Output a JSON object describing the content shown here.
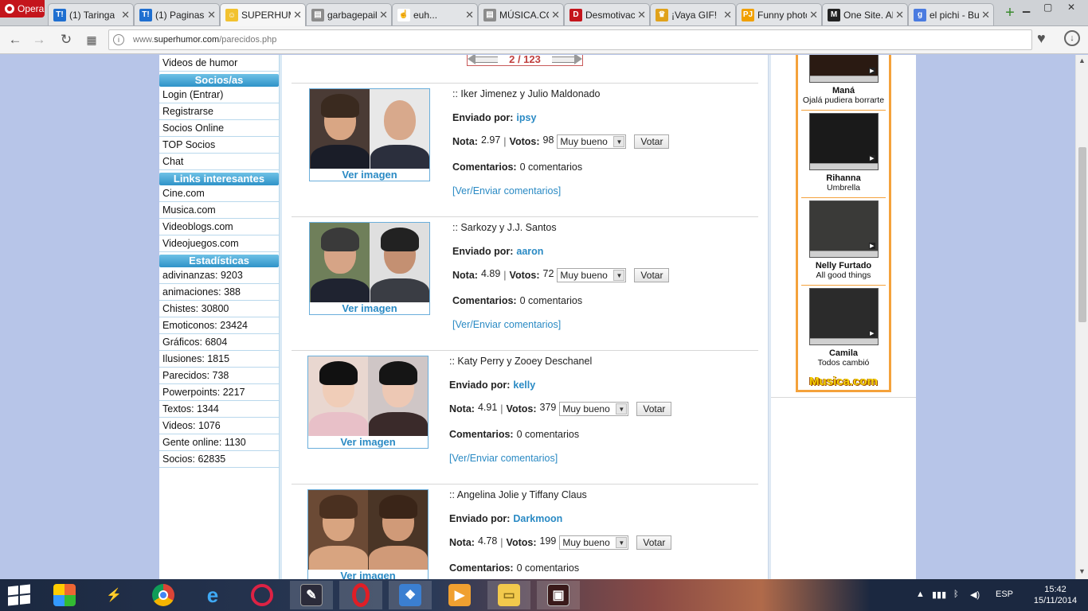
{
  "browser": {
    "menu_label": "Opera",
    "tabs": [
      {
        "label": "(1) Taringa",
        "icon": "taringa-icon",
        "color": "#1f6fd0",
        "glyph": "T!"
      },
      {
        "label": "(1) Paginas",
        "icon": "taringa-icon",
        "color": "#1f6fd0",
        "glyph": "T!"
      },
      {
        "label": "SUPERHUMOR",
        "icon": "smiley-icon",
        "color": "#f2c230",
        "glyph": "☺"
      },
      {
        "label": "garbagepail",
        "icon": "page-icon",
        "color": "#8c8c8c",
        "glyph": "▤"
      },
      {
        "label": "euh...",
        "icon": "hand-cursor-icon",
        "color": "#ffffff",
        "glyph": "☝"
      },
      {
        "label": "MÚSICA.COM",
        "icon": "page-icon",
        "color": "#8c8c8c",
        "glyph": "▤"
      },
      {
        "label": "Desmotivaciones",
        "icon": "desmotivaciones-icon",
        "color": "#c4151c",
        "glyph": "D"
      },
      {
        "label": "¡Vaya GIF!",
        "icon": "trophy-icon",
        "color": "#e0a21b",
        "glyph": "♛"
      },
      {
        "label": "Funny photos",
        "icon": "pj-icon",
        "color": "#f0a000",
        "glyph": "PJ"
      },
      {
        "label": "One Site. All",
        "icon": "m-icon",
        "color": "#222222",
        "glyph": "M"
      },
      {
        "label": "el pichi - Buscar",
        "icon": "google-icon",
        "color": "#4a7be0",
        "glyph": "g"
      }
    ],
    "new_tab_label": "+",
    "url_prefix": "www.",
    "url_domain": "superhumor.com",
    "url_path": "/parecidos.php"
  },
  "left_nav": {
    "top_item": "Videos de humor",
    "sections": [
      {
        "title": "Socios/as",
        "items": [
          "Login (Entrar)",
          "Registrarse",
          "Socios Online",
          "TOP Socios",
          "Chat"
        ]
      },
      {
        "title": "Links interesantes",
        "items": [
          "Cine.com",
          "Musica.com",
          "Videoblogs.com",
          "Videojuegos.com"
        ]
      },
      {
        "title": "Estadísticas",
        "items": [
          "adivinanzas: 9203",
          "animaciones: 388",
          "Chistes: 30800",
          "Emoticonos: 23424",
          "Gráficos: 6804",
          "Ilusiones: 1815",
          "Parecidos: 738",
          "Powerpoints: 2217",
          "Textos: 1344",
          "Videos: 1076",
          "Gente online: 1130",
          "Socios: 62835"
        ]
      }
    ]
  },
  "pager": {
    "label": "2 / 123"
  },
  "labels": {
    "ver_imagen": "Ver imagen",
    "enviado_por": "Enviado por:",
    "nota": "Nota:",
    "votos": "Votos:",
    "comentarios": "Comentarios:",
    "select_value": "Muy bueno",
    "votar": "Votar",
    "ver_enviar": "[Ver/Enviar comentarios]"
  },
  "entries": [
    {
      "title": ":: Iker Jimenez y Julio Maldonado",
      "user": "ipsy",
      "nota": "2.97",
      "votos": "98",
      "comentarios": "0 comentarios",
      "faces": [
        {
          "bg": "#4a3b35",
          "skin": "#d9a684",
          "hair": "#3a2a1f",
          "shirt": "#1a1d28"
        },
        {
          "bg": "#e8e8e8",
          "skin": "#d8a98c",
          "hair": "#d8a98c",
          "shirt": "#2b2f3d"
        }
      ]
    },
    {
      "title": ":: Sarkozy y J.J. Santos",
      "user": "aaron",
      "nota": "4.89",
      "votos": "72",
      "comentarios": "0 comentarios",
      "faces": [
        {
          "bg": "#6f7f5a",
          "skin": "#d6a486",
          "hair": "#3a3a3a",
          "shirt": "#1f2330"
        },
        {
          "bg": "#dfdfdf",
          "skin": "#c49072",
          "hair": "#222222",
          "shirt": "#3a3d44"
        }
      ]
    },
    {
      "title": ":: Katy Perry y Zooey Deschanel",
      "user": "kelly",
      "nota": "4.91",
      "votos": "379",
      "comentarios": "0 comentarios",
      "faces": [
        {
          "bg": "#e9d7d0",
          "skin": "#f0cdb8",
          "hair": "#111111",
          "shirt": "#e8c0c8"
        },
        {
          "bg": "#cfc6c6",
          "skin": "#edc8b4",
          "hair": "#151515",
          "shirt": "#3a2a2a"
        }
      ]
    },
    {
      "title": ":: Angelina Jolie y Tiffany Claus",
      "user": "Darkmoon",
      "nota": "4.78",
      "votos": "199",
      "comentarios": "0 comentarios",
      "faces": [
        {
          "bg": "#6b4a35",
          "skin": "#d8a480",
          "hair": "#4a3020",
          "shirt": "#d8a480"
        },
        {
          "bg": "#4a3526",
          "skin": "#d09a78",
          "hair": "#3a2518",
          "shirt": "#d09a78"
        }
      ]
    }
  ],
  "music": [
    {
      "artist": "Maná",
      "song": "Ojalá pudiera borrarte"
    },
    {
      "artist": "Rihanna",
      "song": "Umbrella"
    },
    {
      "artist": "Nelly Furtado",
      "song": "All good things"
    },
    {
      "artist": "Camila",
      "song": "Todos cambió"
    }
  ],
  "music_logo": "Musica.com",
  "system": {
    "lang": "ESP",
    "time": "15:42",
    "date": "15/11/2014"
  },
  "colors": {
    "link": "#2a8ac4",
    "nav_header": "#2f93c8",
    "music_border": "#f4a23b",
    "opera_red": "#c4151c"
  }
}
